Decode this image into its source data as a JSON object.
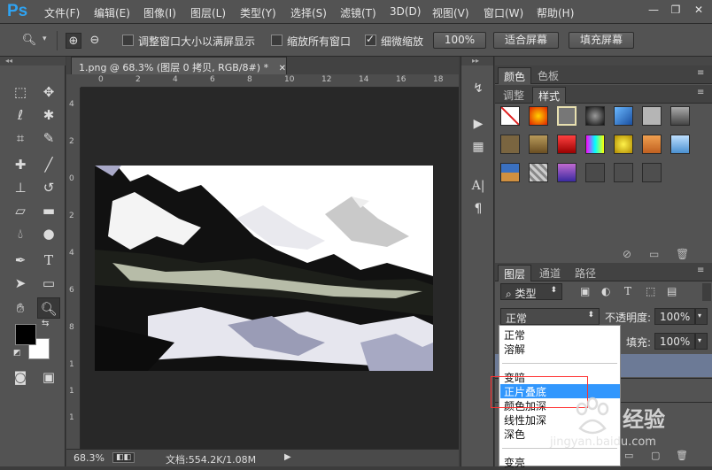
{
  "app": {
    "logo": "Ps"
  },
  "menu": [
    "文件(F)",
    "编辑(E)",
    "图像(I)",
    "图层(L)",
    "类型(Y)",
    "选择(S)",
    "滤镜(T)",
    "3D(D)",
    "视图(V)",
    "窗口(W)",
    "帮助(H)"
  ],
  "window_controls": {
    "minimize": "—",
    "restore": "❐",
    "close": "✕"
  },
  "options": {
    "resize_windows": "调整窗口大小以满屏显示",
    "zoom_all": "缩放所有窗口",
    "scrubby_zoom": "细微缩放",
    "scrubby_checked": true,
    "btn_100": "100%",
    "btn_fit": "适合屏幕",
    "btn_fill": "填充屏幕"
  },
  "document": {
    "tab_title": "1.png @ 68.3% (图层 0 拷贝, RGB/8#) *",
    "ruler_top": [
      "0",
      "2",
      "4",
      "6",
      "8",
      "10",
      "12",
      "14",
      "16",
      "18"
    ],
    "ruler_left": [
      "4",
      "2",
      "0",
      "2",
      "4",
      "6",
      "8",
      "1",
      "1",
      "1"
    ],
    "status_zoom": "68.3%",
    "status_doc": "文档:554.2K/1.08M"
  },
  "panels": {
    "top_tabs": [
      "颜色",
      "色板"
    ],
    "style_tabs": [
      "调整",
      "样式"
    ],
    "layer_tabs": [
      "图层",
      "通道",
      "路径"
    ],
    "kind_filter": "类型",
    "blend_mode": "正常",
    "opacity_label": "不透明度:",
    "opacity_value": "100%",
    "fill_label": "填充:",
    "fill_value": "100%"
  },
  "blend_menu": {
    "items": [
      "正常",
      "溶解",
      "变暗",
      "正片叠底",
      "颜色加深",
      "线性加深",
      "深色",
      "变亮"
    ],
    "selected": "正片叠底"
  },
  "watermark": {
    "brand": "经验",
    "site": "jingyan.baidu.com"
  },
  "colors": {
    "accent": "#3297fd",
    "annotation": "#ff3030",
    "logo": "#2fa3f2"
  }
}
